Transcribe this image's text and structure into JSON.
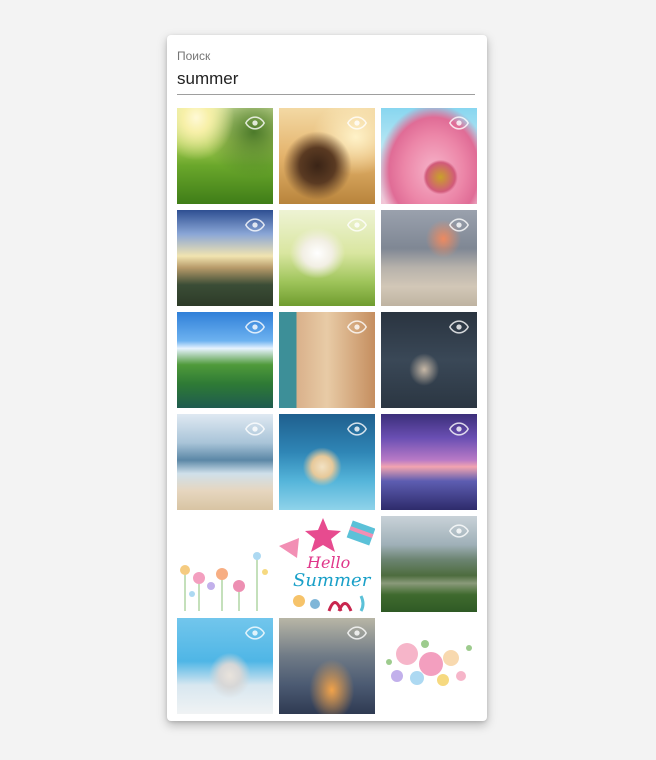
{
  "search": {
    "label": "Поиск",
    "value": "summer"
  },
  "tile_text": {
    "hello": "Hello",
    "summer": "Summer"
  },
  "icons": {
    "eye": "eye-icon"
  },
  "colors": {
    "page_bg": "#f3f3f3",
    "panel_bg": "#ffffff",
    "underline": "#9e9e9e"
  },
  "images": [
    {
      "name": "sunny-meadow-image",
      "eye": true
    },
    {
      "name": "girl-sunset-field-image",
      "eye": true
    },
    {
      "name": "pink-flower-image",
      "eye": true
    },
    {
      "name": "mountain-sunrays-image",
      "eye": true
    },
    {
      "name": "girl-hat-meadow-image",
      "eye": true
    },
    {
      "name": "beach-palm-sunset-image",
      "eye": true
    },
    {
      "name": "lake-hills-image",
      "eye": true
    },
    {
      "name": "cafe-street-image",
      "eye": true
    },
    {
      "name": "children-image",
      "eye": true
    },
    {
      "name": "woman-beach-image",
      "eye": true
    },
    {
      "name": "ice-cream-image",
      "eye": true
    },
    {
      "name": "boat-lake-purple-sunset-image",
      "eye": true
    },
    {
      "name": "watercolor-flowers-image",
      "eye": false
    },
    {
      "name": "hello-summer-image",
      "eye": false
    },
    {
      "name": "mountain-lake-image",
      "eye": true
    },
    {
      "name": "pool-hat-image",
      "eye": true
    },
    {
      "name": "flowers-sunset-image",
      "eye": true
    },
    {
      "name": "watercolor-roses-image",
      "eye": false
    }
  ]
}
